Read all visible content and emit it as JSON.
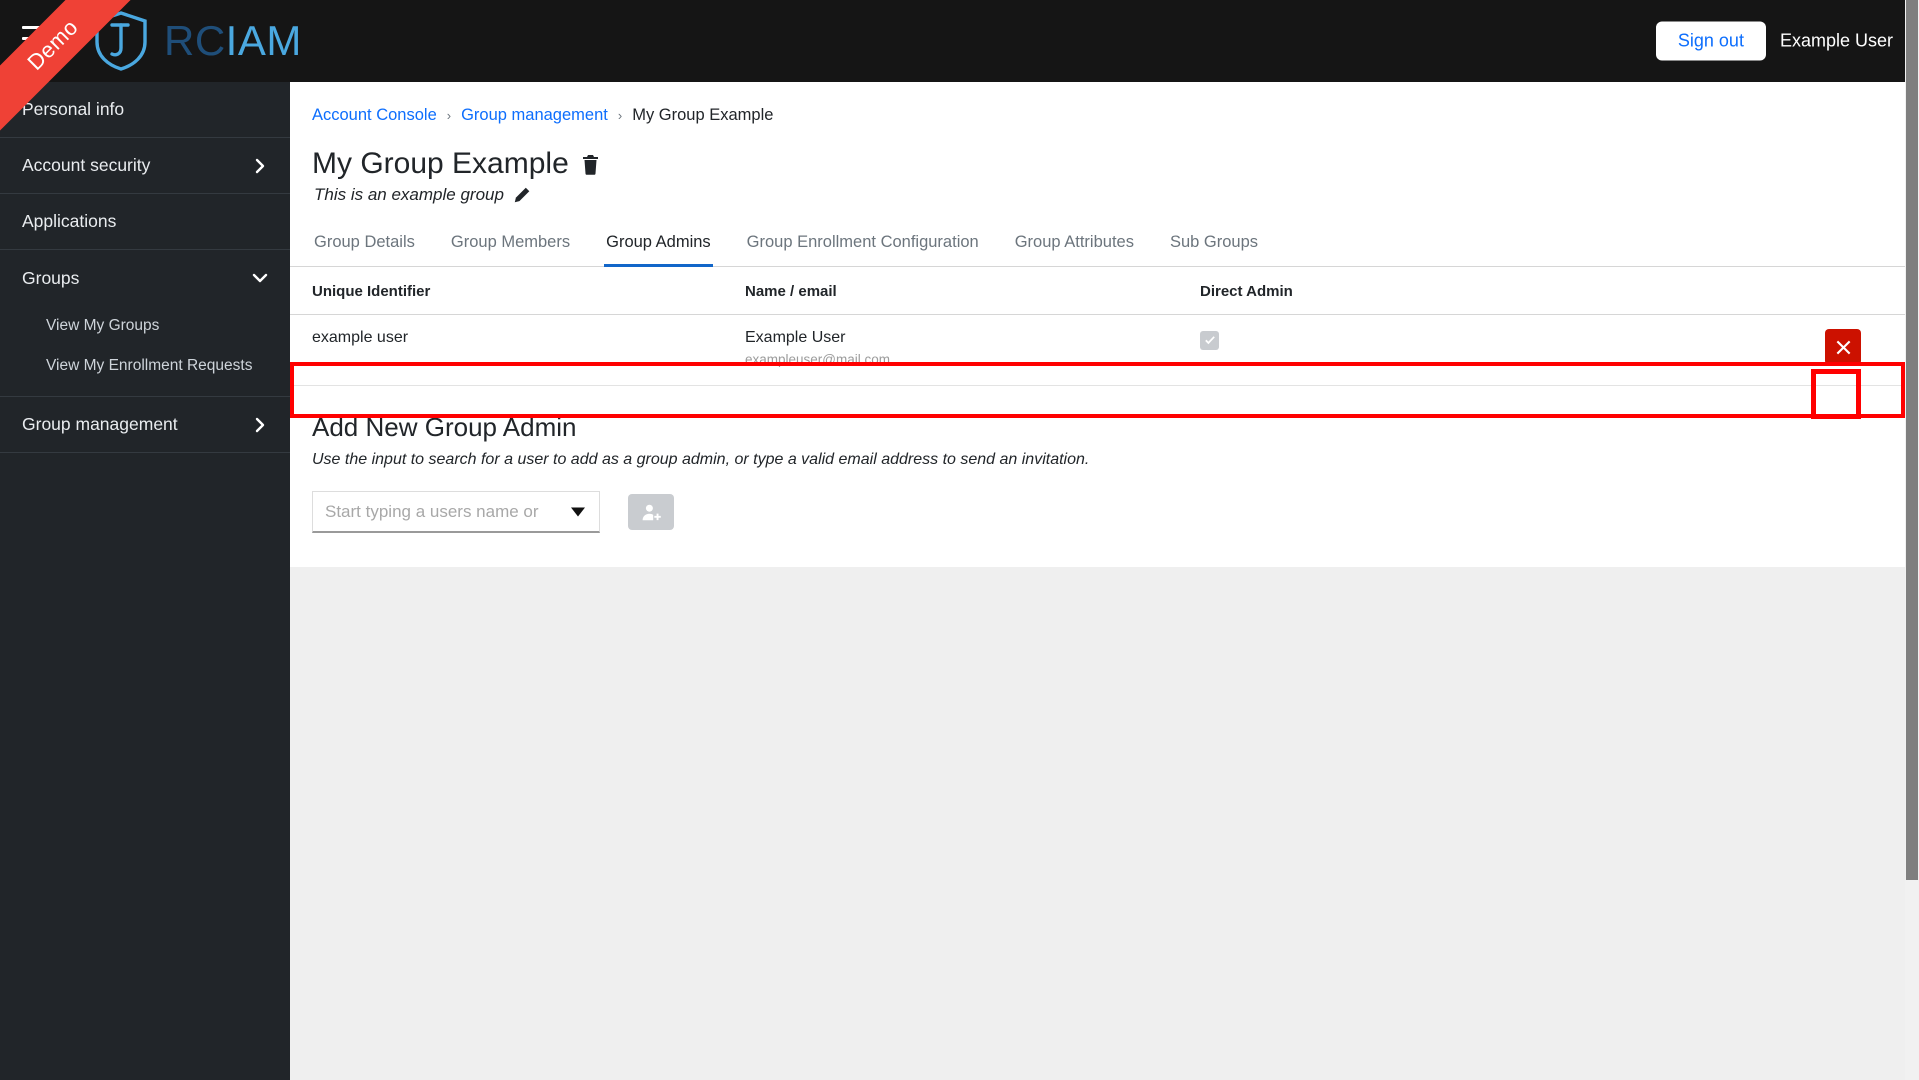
{
  "header": {
    "menu_icon": "hamburger-menu-icon",
    "brand_prefix": "RC",
    "brand_suffix": "IAM",
    "logo_icon": "shield-logo-icon",
    "signout_label": "Sign out",
    "username": "Example User",
    "ribbon_label": "Demo",
    "ribbon_color": "#ef4136",
    "background": "#151515"
  },
  "sidebar": {
    "background": "#212529",
    "items": [
      {
        "label": "Personal info",
        "expandable": false,
        "state": ""
      },
      {
        "label": "Account security",
        "expandable": true,
        "state": "collapsed"
      },
      {
        "label": "Applications",
        "expandable": false,
        "state": ""
      },
      {
        "label": "Groups",
        "expandable": true,
        "state": "expanded"
      },
      {
        "label": "Group management",
        "expandable": true,
        "state": "collapsed"
      }
    ],
    "group_children": [
      {
        "label": "View My Groups"
      },
      {
        "label": "View My Enrollment Requests"
      }
    ]
  },
  "breadcrumb": {
    "items": [
      {
        "label": "Account Console",
        "link": true
      },
      {
        "label": "Group management",
        "link": true
      },
      {
        "label": "My Group Example",
        "link": false
      }
    ],
    "separator": "›"
  },
  "page": {
    "title": "My Group Example",
    "delete_icon": "trash-icon",
    "description": "This is an example group",
    "edit_icon": "pencil-icon"
  },
  "tabs": [
    {
      "label": "Group Details",
      "active": false
    },
    {
      "label": "Group Members",
      "active": false
    },
    {
      "label": "Group Admins",
      "active": true
    },
    {
      "label": "Group Enrollment Configuration",
      "active": false
    },
    {
      "label": "Group Attributes",
      "active": false
    },
    {
      "label": "Sub Groups",
      "active": false
    }
  ],
  "tab_accent_color": "#1266c9",
  "table": {
    "columns": [
      "Unique Identifier",
      "Name / email",
      "Direct Admin",
      ""
    ],
    "rows": [
      {
        "unique_identifier": "example user",
        "name": "Example User",
        "email": "exampleuser@mail.com",
        "direct_admin": true,
        "direct_admin_disabled": true,
        "remove_icon": "x-close-icon"
      }
    ]
  },
  "highlight_color": "#ff0000",
  "add_section": {
    "title": "Add New Group Admin",
    "description": "Use the input to search for a user to add as a group admin, or type a valid email address to send an invitation.",
    "input_placeholder": "Start typing a users name or e...",
    "input_value": "",
    "dropdown_icon": "chevron-down-icon",
    "add_button_icon": "add-user-icon",
    "add_button_disabled": true
  }
}
